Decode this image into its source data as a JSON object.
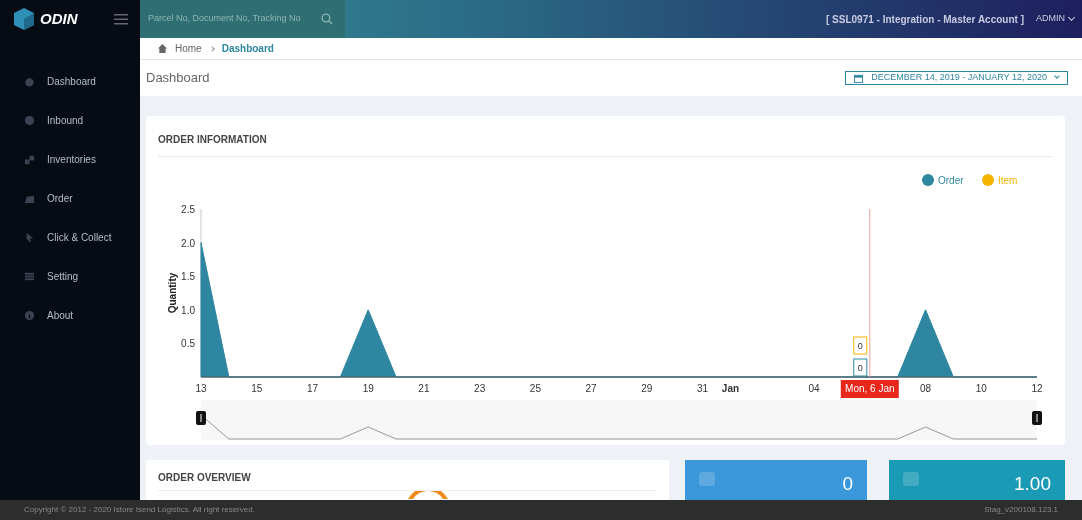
{
  "header": {
    "logo": "ODIN",
    "search": {
      "placeholder": "Parcel No, Document No, Tracking No"
    },
    "account": "[ SSL0971 - Integration - Master Account ]",
    "user": "ADMIN"
  },
  "sidebar": {
    "items": [
      {
        "label": "Dashboard",
        "selected": false
      },
      {
        "label": "Inbound",
        "selected": false
      },
      {
        "label": "Inventories",
        "selected": false
      },
      {
        "label": "Order",
        "selected": false
      },
      {
        "label": "Click & Collect",
        "selected": false
      },
      {
        "label": "Setting",
        "selected": false
      },
      {
        "label": "About",
        "selected": false
      }
    ]
  },
  "breadcrumb": [
    "Home",
    "Dashboard"
  ],
  "page_title": "Dashboard",
  "date_range": "DECEMBER 14, 2019 - JANUARY 12, 2020",
  "order_information": {
    "title": "ORDER INFORMATION",
    "chart_data": {
      "type": "area",
      "ylabel": "Quantity",
      "categories": [
        "13",
        null,
        "15",
        null,
        "17",
        null,
        "19",
        null,
        "21",
        null,
        "23",
        null,
        "25",
        null,
        "27",
        null,
        "29",
        null,
        "31",
        "Jan",
        null,
        null,
        "04",
        null,
        null,
        null,
        "08",
        null,
        "10",
        null,
        "12"
      ],
      "series": [
        {
          "name": "Order",
          "color": "#2e86a0",
          "values": [
            2,
            0,
            0,
            0,
            0,
            0,
            1,
            0,
            0,
            0,
            0,
            0,
            0,
            0,
            0,
            0,
            0,
            0,
            0,
            0,
            0,
            0,
            0,
            0,
            0,
            0,
            1,
            0,
            0,
            0,
            0
          ]
        }
      ],
      "ylim": [
        0,
        2.5
      ],
      "yticks": [
        0.5,
        {
          "value": 1,
          "label": "1.0"
        },
        1.5,
        {
          "value": 2,
          "label": "2.0"
        },
        2.5
      ]
    },
    "legend_extra": [
      {
        "name": "Item",
        "color": "#f4b400"
      }
    ],
    "tooltip": {
      "date": "Mon, 6 Jan",
      "values": [
        "0",
        "0"
      ]
    }
  },
  "order_overview": {
    "title": "ORDER OVERVIEW"
  },
  "stat_cards": [
    {
      "value": "0",
      "color": "#3a97d9"
    },
    {
      "value": "1.00",
      "color": "#1b9ab5"
    }
  ],
  "footer": {
    "copyright": "Copyright © 2012 - 2020 Istore Isend Logistics. All right reserved.",
    "version": "Stag_v200108.123.1"
  }
}
